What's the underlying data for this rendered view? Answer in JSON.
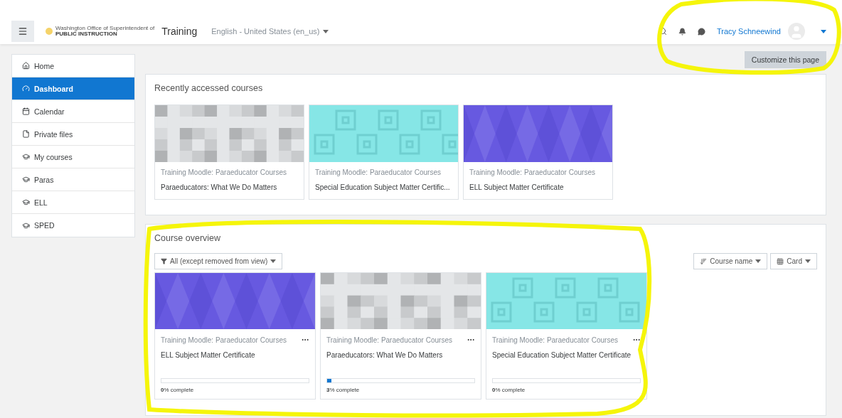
{
  "navbar": {
    "logo_small": "Washington Office of Superintendent of",
    "logo_main": "PUBLIC INSTRUCTION",
    "site_name": "Training",
    "language": "English - United States (en_us)",
    "user_name": "Tracy Schneewind"
  },
  "customize_button": "Customize this page",
  "sidebar": {
    "items": [
      {
        "label": "Home",
        "kind": "home",
        "selected": false
      },
      {
        "label": "Dashboard",
        "kind": "dashboard",
        "selected": true
      },
      {
        "label": "Calendar",
        "kind": "calendar",
        "selected": false
      },
      {
        "label": "Private files",
        "kind": "file",
        "selected": false
      },
      {
        "label": "My courses",
        "kind": "course",
        "selected": false
      },
      {
        "label": "Paras",
        "kind": "course",
        "selected": false
      },
      {
        "label": "ELL",
        "kind": "course",
        "selected": false
      },
      {
        "label": "SPED",
        "kind": "course",
        "selected": false
      }
    ]
  },
  "recent_courses": {
    "title": "Recently accessed courses",
    "courses": [
      {
        "kind": "pixels",
        "category": "Training Moodle: Paraeducator Courses",
        "name": "Paraeducators: What We Do Matters"
      },
      {
        "kind": "squares",
        "category": "Training Moodle: Paraeducator Courses",
        "name": "Special Education Subject Matter Certific..."
      },
      {
        "kind": "diamonds",
        "category": "Training Moodle: Paraeducator Courses",
        "name": "ELL Subject Matter Certificate"
      }
    ]
  },
  "course_overview": {
    "title": "Course overview",
    "filter": "All (except removed from view)",
    "sort": "Course name",
    "view": "Card",
    "courses": [
      {
        "kind": "diamonds",
        "category": "Training Moodle: Paraeducator Courses",
        "name": "ELL Subject Matter Certificate",
        "level": 0,
        "progress": "**0**% complete"
      },
      {
        "kind": "pixels",
        "category": "Training Moodle: Paraeducator Courses",
        "name": "Paraeducators: What We Do Matters",
        "level": 0.03,
        "progress": "**3**% complete"
      },
      {
        "kind": "squares",
        "category": "Training Moodle: Paraeducator Courses",
        "name": "Special Education Subject Matter Certificate",
        "level": 0,
        "progress": "**0**% complete"
      }
    ]
  },
  "annotations": [
    {
      "kind": "loop"
    },
    {
      "kind": "loop"
    }
  ]
}
